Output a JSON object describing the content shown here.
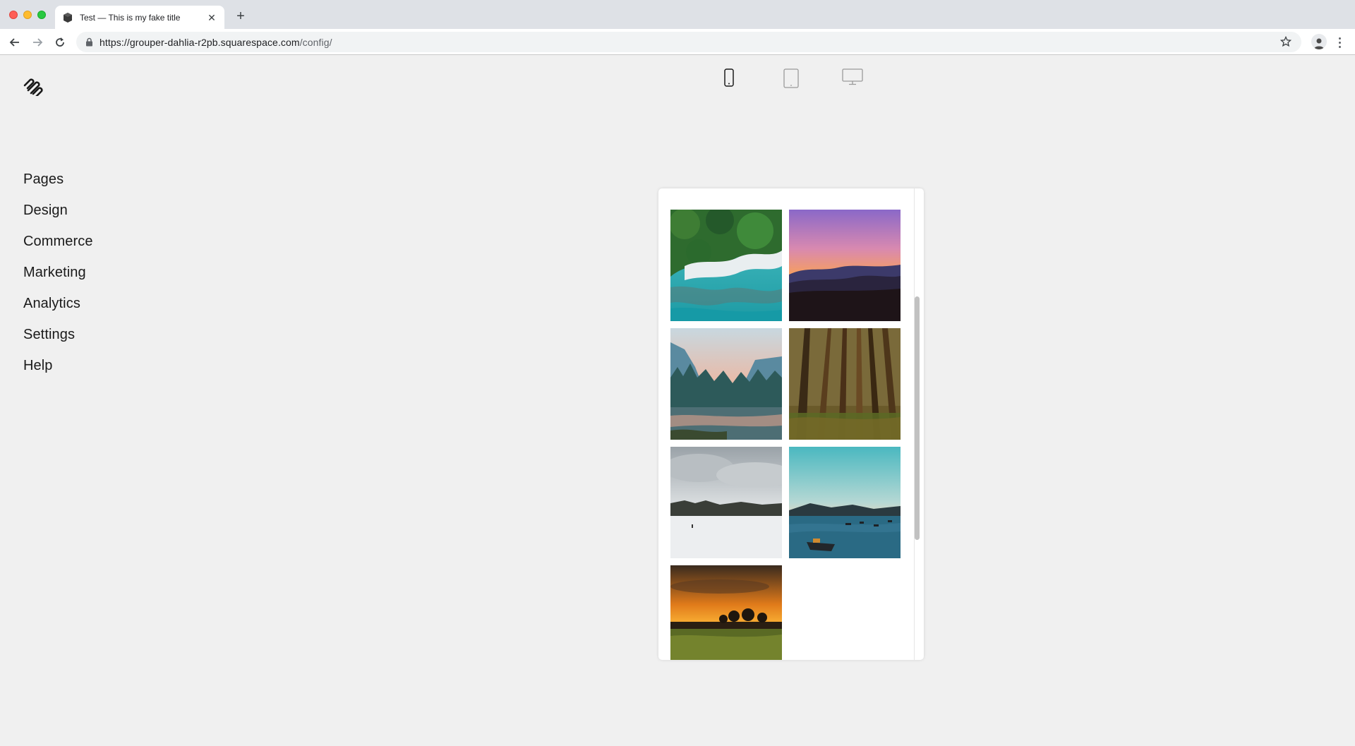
{
  "browser": {
    "tab_title": "Test — This is my fake title",
    "new_tab_label": "+",
    "url_host": "https://grouper-dahlia-r2pb.squarespace.com",
    "url_path": "/config/",
    "icons": {
      "back": "arrow-left-icon",
      "forward": "arrow-right-icon",
      "reload": "reload-icon",
      "lock": "lock-icon",
      "star": "star-icon",
      "menu": "kebab-menu-icon"
    }
  },
  "sidebar": {
    "logo": "squarespace-logo",
    "items": [
      {
        "label": "Pages"
      },
      {
        "label": "Design"
      },
      {
        "label": "Commerce"
      },
      {
        "label": "Marketing"
      },
      {
        "label": "Analytics"
      },
      {
        "label": "Settings"
      },
      {
        "label": "Help"
      }
    ]
  },
  "device_switcher": {
    "options": [
      "mobile-icon",
      "tablet-icon",
      "desktop-icon"
    ],
    "selected": "mobile-icon"
  },
  "preview": {
    "gallery": [
      {
        "name": "aerial-coast-image"
      },
      {
        "name": "purple-sunset-mountains-image"
      },
      {
        "name": "valley-river-image"
      },
      {
        "name": "pine-forest-image"
      },
      {
        "name": "snowy-field-image"
      },
      {
        "name": "lake-boats-image"
      },
      {
        "name": "golden-sunset-field-image"
      }
    ]
  },
  "colors": {
    "background": "#f0f0f0",
    "text": "#1a1a1a",
    "tabbar": "#dee1e6"
  }
}
